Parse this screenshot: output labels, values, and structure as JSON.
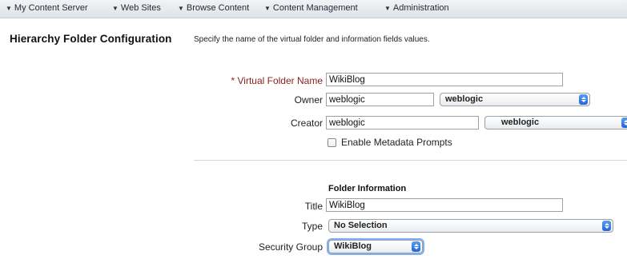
{
  "nav": {
    "items": [
      {
        "label": "My Content Server"
      },
      {
        "label": "Web Sites"
      },
      {
        "label": "Browse Content"
      },
      {
        "label": "Content Management"
      },
      {
        "label": "Administration"
      }
    ]
  },
  "page": {
    "title": "Hierarchy Folder Configuration",
    "description": "Specify the name of the virtual folder and information fields values."
  },
  "form": {
    "virtual_folder": {
      "label": "* Virtual Folder Name",
      "value": "WikiBlog"
    },
    "owner": {
      "label": "Owner",
      "value": "weblogic",
      "select": "weblogic"
    },
    "creator": {
      "label": "Creator",
      "value": "weblogic",
      "select": "weblogic"
    },
    "metadata_prompts": {
      "label": "Enable Metadata Prompts",
      "checked": false
    },
    "folder_info": {
      "heading": "Folder Information",
      "title": {
        "label": "Title",
        "value": "WikiBlog"
      },
      "type": {
        "label": "Type",
        "value": "No Selection"
      },
      "security_group": {
        "label": "Security Group",
        "value": "WikiBlog"
      }
    }
  },
  "colors": {
    "required_label": "#8a1d1d",
    "select_arrow": "#2366d6"
  },
  "icons": [
    "chevron-down-icon",
    "select-arrows-icon",
    "checkbox-icon"
  ]
}
